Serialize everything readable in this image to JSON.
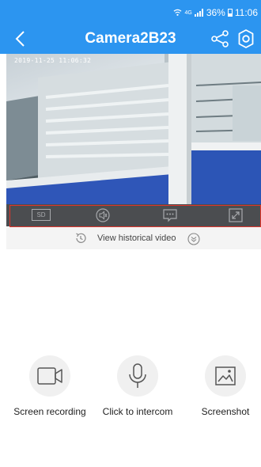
{
  "status_bar": {
    "network_label": "4G",
    "battery_percent_text": "36%",
    "time": "11:06"
  },
  "header": {
    "title": "Camera2B23",
    "back_icon": "chevron-left-icon",
    "share_icon": "share-icon",
    "settings_icon": "gear-icon"
  },
  "video": {
    "timestamp": "2019-11-25  11:06:32"
  },
  "controls": {
    "quality_label": "SD",
    "items": [
      "sd-quality-button",
      "speaker-icon",
      "message-icon",
      "fullscreen-icon"
    ]
  },
  "history": {
    "label": "View historical video",
    "left_icon": "history-clock-icon",
    "right_icon": "expand-down-icon"
  },
  "actions": [
    {
      "label": "Screen recording",
      "icon": "video-camera-icon"
    },
    {
      "label": "Click to intercom",
      "icon": "microphone-icon"
    },
    {
      "label": "Screenshot",
      "icon": "image-icon"
    }
  ],
  "colors": {
    "brand_blue": "#2c95f0",
    "control_bar": "#4b4d50",
    "highlight_border": "#e0352b"
  }
}
